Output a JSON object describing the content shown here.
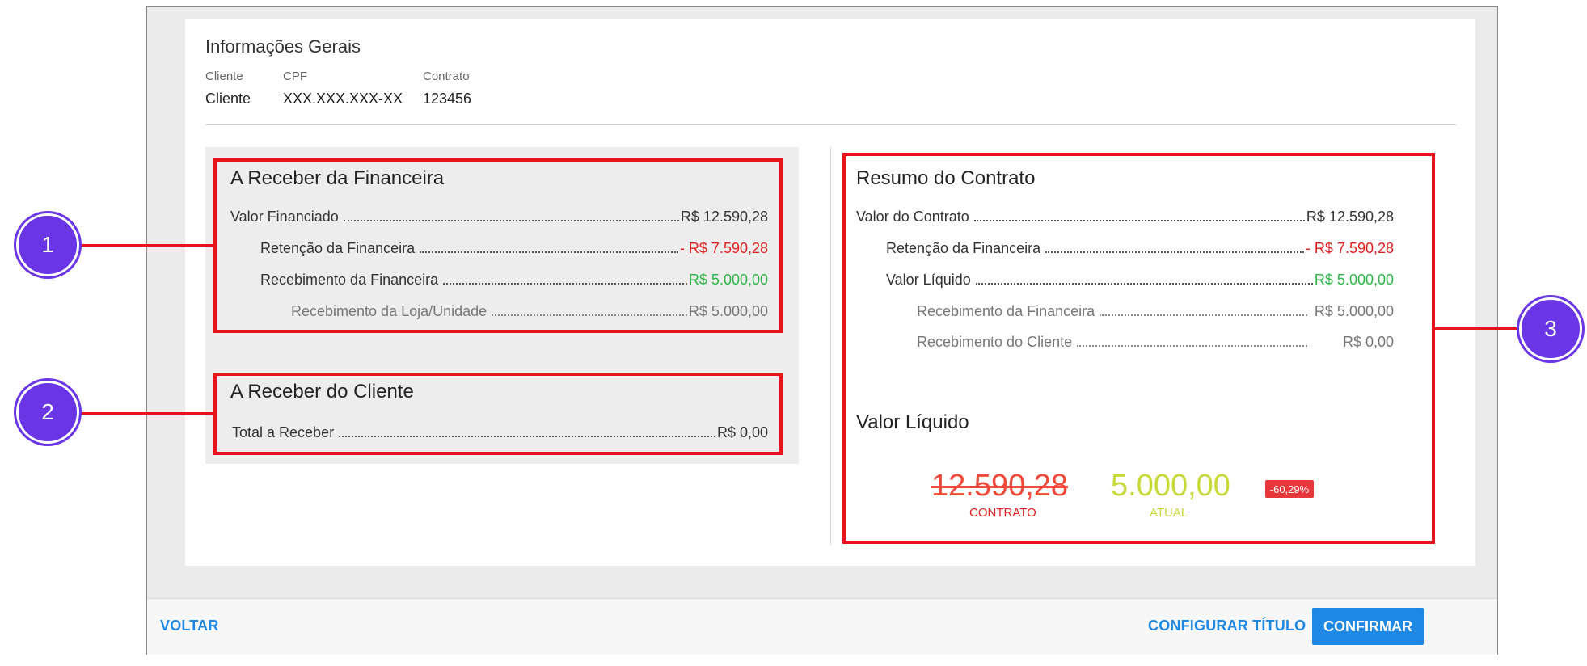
{
  "general": {
    "title": "Informações Gerais",
    "fields": [
      {
        "label": "Cliente",
        "value": "Cliente"
      },
      {
        "label": "CPF",
        "value": "XXX.XXX.XXX-XX"
      },
      {
        "label": "Contrato",
        "value": "123456"
      }
    ]
  },
  "financeira": {
    "title": "A Receber da Financeira",
    "rows": [
      {
        "label": "Valor Financiado",
        "amount": "R$ 12.590,28"
      },
      {
        "label": "Retenção da Financeira",
        "amount": "- R$ 7.590,28"
      },
      {
        "label": "Recebimento da Financeira",
        "amount": "R$ 5.000,00"
      },
      {
        "label": "Recebimento da Loja/Unidade",
        "amount": "R$ 5.000,00"
      }
    ]
  },
  "cliente": {
    "title": "A Receber do Cliente",
    "rows": [
      {
        "label": "Total a Receber",
        "amount": "R$ 0,00"
      }
    ]
  },
  "resumo": {
    "title": "Resumo do Contrato",
    "rows": [
      {
        "label": "Valor do Contrato",
        "amount": "R$ 12.590,28"
      },
      {
        "label": "Retenção da Financeira",
        "amount": "- R$ 7.590,28"
      },
      {
        "label": "Valor Líquido",
        "amount": "R$ 5.000,00"
      },
      {
        "label": "Recebimento da Financeira",
        "amount": "R$ 5.000,00"
      },
      {
        "label": "Recebimento do Cliente",
        "amount": "R$ 0,00"
      }
    ]
  },
  "liquido": {
    "title": "Valor Líquido",
    "contrato_value": "12.590,28",
    "contrato_label": "CONTRATO",
    "atual_value": "5.000,00",
    "atual_label": "ATUAL",
    "variation": "-60,29%"
  },
  "callouts": [
    "1",
    "2",
    "3"
  ],
  "footer": {
    "back": "VOLTAR",
    "configure": "CONFIGURAR TÍTULO",
    "confirm": "CONFIRMAR"
  },
  "colors": {
    "accent": "#1e88e5",
    "highlight_box": "#e8141b",
    "callout": "#6a35e4",
    "negative": "#e02020",
    "positive": "#2db548",
    "atual": "#c8d93a"
  }
}
